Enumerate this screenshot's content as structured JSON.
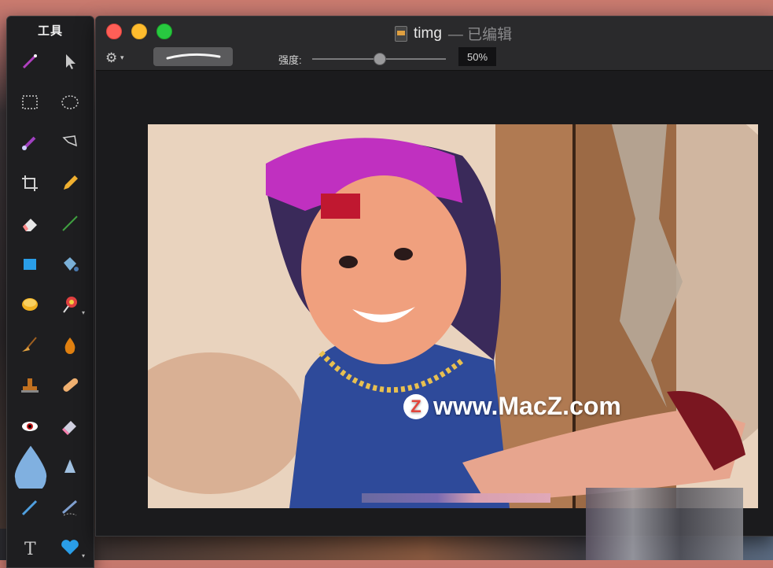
{
  "tools_panel": {
    "title": "工具",
    "tools": [
      {
        "icon": "magic-wand-icon",
        "color": "#b040c0"
      },
      {
        "icon": "arrow-pointer-icon",
        "color": "#c8c8c8"
      },
      {
        "icon": "rect-select-icon",
        "color": "#d0d0d0"
      },
      {
        "icon": "ellipse-select-icon",
        "color": "#d0d0d0"
      },
      {
        "icon": "brush-select-icon",
        "color": "#a040c0"
      },
      {
        "icon": "lasso-icon",
        "color": "#d0d0d0"
      },
      {
        "icon": "crop-icon",
        "color": "#d0d0d0"
      },
      {
        "icon": "pencil-icon",
        "color": "#f0b030"
      },
      {
        "icon": "eraser-icon",
        "color": "#e8e8e8"
      },
      {
        "icon": "line-icon",
        "color": "#40a040"
      },
      {
        "icon": "rectangle-shape-icon",
        "color": "#2a9ee8"
      },
      {
        "icon": "paint-bucket-icon",
        "color": "#7ab0d8"
      },
      {
        "icon": "coin-icon",
        "color": "#f0b020"
      },
      {
        "icon": "lollipop-icon",
        "color": "#e04040"
      },
      {
        "icon": "broom-icon",
        "color": "#e0a040"
      },
      {
        "icon": "drop-burn-icon",
        "color": "#e08010"
      },
      {
        "icon": "stamp-icon",
        "color": "#c07020"
      },
      {
        "icon": "bandage-icon",
        "color": "#f0b070"
      },
      {
        "icon": "red-eye-icon",
        "color": "#d0d0d0"
      },
      {
        "icon": "smudge-eraser-icon",
        "color": "#d0d0e0"
      },
      {
        "icon": "water-drop-icon",
        "color": "#80b0e0"
      },
      {
        "icon": "sharpen-cone-icon",
        "color": "#a0c0e0"
      },
      {
        "icon": "pen-icon",
        "color": "#50a0e0"
      },
      {
        "icon": "vector-pen-icon",
        "color": "#80a0d0"
      },
      {
        "icon": "text-tool-icon",
        "color": "#c8c8c8"
      },
      {
        "icon": "heart-shape-icon",
        "color": "#2a9ee8"
      }
    ]
  },
  "window": {
    "title": "timg",
    "edited": "— 已编辑"
  },
  "toolbar": {
    "strength_label": "强度:",
    "strength_value": "50%",
    "strength_fraction": 0.5
  },
  "canvas": {
    "watermark_badge": "Z",
    "watermark_text": "www.MacZ.com"
  }
}
